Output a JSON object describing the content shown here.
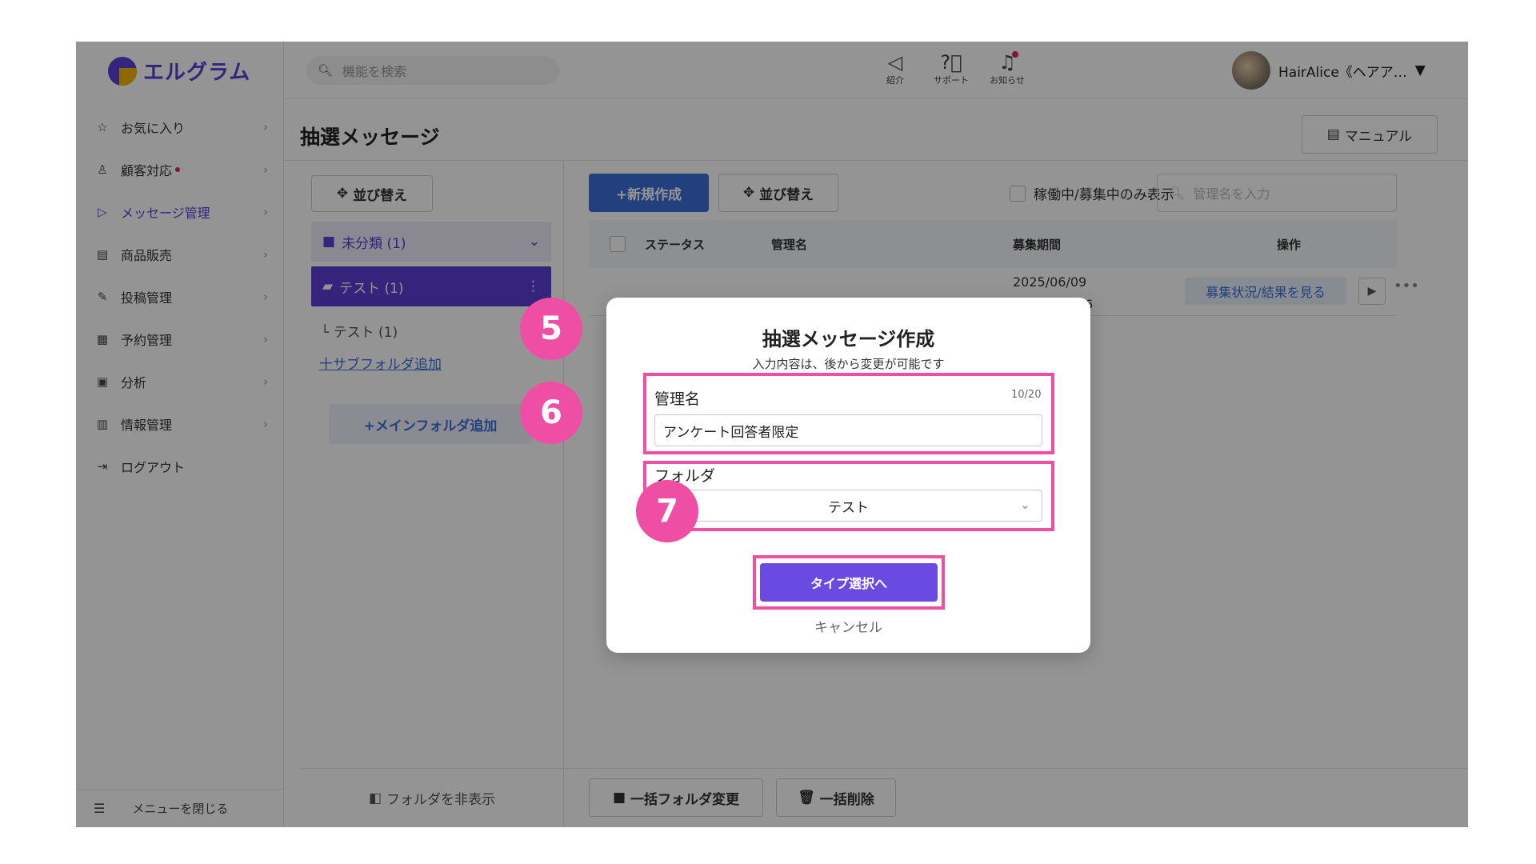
{
  "logo": {
    "text": "エルグラム"
  },
  "sidebar": {
    "items": [
      {
        "label": "お気に入り",
        "icon": "star-icon"
      },
      {
        "label": "顧客対応",
        "icon": "person-icon",
        "dot": true
      },
      {
        "label": "メッセージ管理",
        "icon": "send-icon",
        "active": true
      },
      {
        "label": "商品販売",
        "icon": "store-icon"
      },
      {
        "label": "投稿管理",
        "icon": "edit-icon"
      },
      {
        "label": "予約管理",
        "icon": "calendar-icon"
      },
      {
        "label": "分析",
        "icon": "analysis-icon"
      },
      {
        "label": "情報管理",
        "icon": "chart-icon"
      },
      {
        "label": "ログアウト",
        "icon": "logout-icon"
      }
    ],
    "close_label": "メニューを閉じる"
  },
  "header": {
    "search_placeholder": "機能を検索",
    "icons": [
      {
        "label": "紹介",
        "icon": "megaphone-icon"
      },
      {
        "label": "サポート",
        "icon": "help-icon"
      },
      {
        "label": "お知らせ",
        "icon": "bell-icon"
      }
    ],
    "user_name": "HairAlice《ヘアア…"
  },
  "page": {
    "title": "抽選メッセージ",
    "manual_label": "マニュアル"
  },
  "folders": {
    "sort_label": "並び替え",
    "uncategorized": "未分類 (1)",
    "selected": "テスト (1)",
    "sub": "└ テスト (1)",
    "add_sub": "十サブフォルダ追加",
    "add_main": "+メインフォルダ追加",
    "hide_label": "フォルダを非表示"
  },
  "list": {
    "new_label": "+新規作成",
    "sort_label": "並び替え",
    "filter_label": "稼働中/募集中のみ表示",
    "search_placeholder": "管理名を入力",
    "columns": {
      "status": "ステータス",
      "name": "管理名",
      "period": "募集期間",
      "ops": "操作"
    },
    "row": {
      "period_start": "2025/06/09",
      "period_end": "〜2025/06/16",
      "result_label": "募集状況/結果を見る",
      "more": "•••"
    },
    "bulk_folder": "一括フォルダ変更",
    "bulk_delete": "一括削除"
  },
  "modal": {
    "title": "抽選メッセージ作成",
    "subtitle": "入力内容は、後から変更が可能です",
    "name_label": "管理名",
    "name_counter": "10/20",
    "name_value": "アンケート回答者限定",
    "folder_label": "フォルダ",
    "folder_value": "テスト",
    "submit_label": "タイプ選択へ",
    "cancel_label": "キャンセル"
  },
  "steps": [
    "5",
    "6",
    "7"
  ],
  "colors": {
    "accent": "#5b3fd6",
    "primary": "#3a6fd8",
    "highlight": "#ef4ea5"
  }
}
